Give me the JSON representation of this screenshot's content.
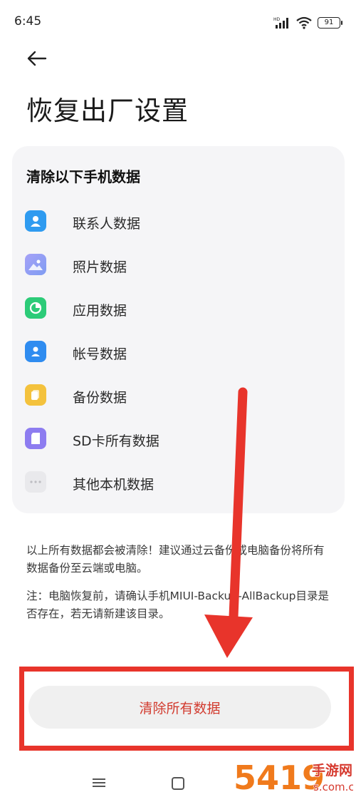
{
  "status_bar": {
    "time": "6:45",
    "battery": "91",
    "network_label": "HD"
  },
  "header": {
    "title": "恢复出厂设置"
  },
  "card": {
    "title": "清除以下手机数据",
    "items": [
      {
        "label": "联系人数据",
        "icon": "contact-icon",
        "color": "#2f9bf0"
      },
      {
        "label": "照片数据",
        "icon": "photo-icon",
        "color": "#8a86f2"
      },
      {
        "label": "应用数据",
        "icon": "pie-chart-icon",
        "color": "#2ccb78"
      },
      {
        "label": "帐号数据",
        "icon": "account-icon",
        "color": "#2f8cf0"
      },
      {
        "label": "备份数据",
        "icon": "backup-icon",
        "color": "#f4c23d"
      },
      {
        "label": "SD卡所有数据",
        "icon": "sd-card-icon",
        "color": "#8d7cf0"
      },
      {
        "label": "其他本机数据",
        "icon": "more-icon",
        "color": "#e9e9ec"
      }
    ]
  },
  "notes": {
    "warning": "以上所有数据都会被清除！建议通过云备份或电脑备份将所有数据备份至云端或电脑。",
    "note": "注：电脑恢复前，请确认手机MIUI-Backup-AllBackup目录是否存在，若无请新建该目录。"
  },
  "action": {
    "clear_all_label": "清除所有数据"
  },
  "annotation": {
    "arrow_color": "#e8342b"
  },
  "watermark": {
    "text": "5419手游网",
    "domain": "s.com.cn"
  }
}
